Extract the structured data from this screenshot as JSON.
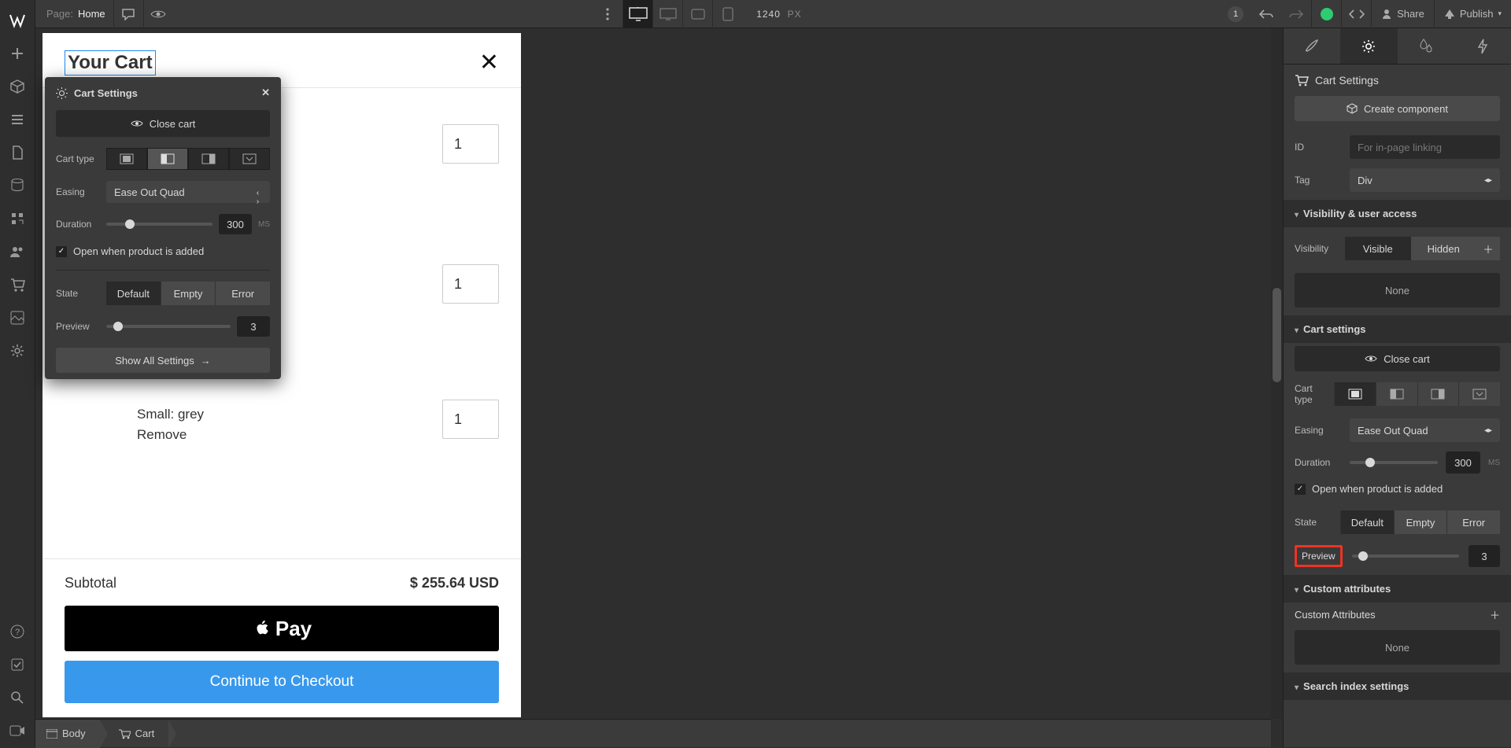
{
  "top_bar": {
    "page_label": "Page:",
    "page_name": "Home",
    "canvas_width": "1240",
    "canvas_unit": "PX",
    "notif_count": "1",
    "share": "Share",
    "publish": "Publish"
  },
  "left_tools": {
    "items": [
      "add",
      "cube",
      "menu",
      "page",
      "db",
      "tree",
      "users",
      "cart",
      "apps",
      "settings"
    ],
    "bottom": [
      "help",
      "check",
      "search",
      "video"
    ]
  },
  "breadcrumb": {
    "items": [
      {
        "icon": "layout",
        "label": "Body"
      },
      {
        "icon": "cart",
        "label": "Cart"
      }
    ]
  },
  "cart_panel": {
    "title": "Your Cart",
    "items": [
      {
        "variant": "",
        "remove": "",
        "qty": "1"
      },
      {
        "variant": "",
        "remove": "",
        "qty": "1"
      },
      {
        "variant": "Small: grey",
        "remove": "Remove",
        "qty": "1"
      }
    ],
    "subtotal_label": "Subtotal",
    "subtotal_value": "$ 255.64 USD",
    "applepay_label": "Pay",
    "checkout_label": "Continue to Checkout"
  },
  "popover": {
    "title": "Cart Settings",
    "close_cart": "Close cart",
    "cart_type_label": "Cart type",
    "easing_label": "Easing",
    "easing_value": "Ease Out Quad",
    "duration_label": "Duration",
    "duration_value": "300",
    "duration_unit": "MS",
    "open_checkbox": "Open when product is added",
    "state_label": "State",
    "states": [
      "Default",
      "Empty",
      "Error"
    ],
    "preview_label": "Preview",
    "preview_value": "3",
    "show_all": "Show All Settings"
  },
  "right_panel": {
    "tabs": [
      "brush",
      "gear",
      "drop",
      "bolt"
    ],
    "header_title": "Cart Settings",
    "create_component": "Create component",
    "id_label": "ID",
    "id_placeholder": "For in-page linking",
    "tag_label": "Tag",
    "tag_value": "Div",
    "section_visibility": "Visibility & user access",
    "visibility_label": "Visibility",
    "vis_visible": "Visible",
    "vis_hidden": "Hidden",
    "none": "None",
    "section_cart": "Cart settings",
    "close_cart": "Close cart",
    "cart_type_label": "Cart type",
    "easing_label": "Easing",
    "easing_value": "Ease Out Quad",
    "duration_label": "Duration",
    "duration_value": "300",
    "duration_unit": "MS",
    "open_checkbox": "Open when product is added",
    "state_label": "State",
    "states": [
      "Default",
      "Empty",
      "Error"
    ],
    "preview_label": "Preview",
    "preview_value": "3",
    "section_custom": "Custom attributes",
    "custom_attrs_label": "Custom Attributes",
    "none2": "None",
    "section_search": "Search index settings"
  }
}
